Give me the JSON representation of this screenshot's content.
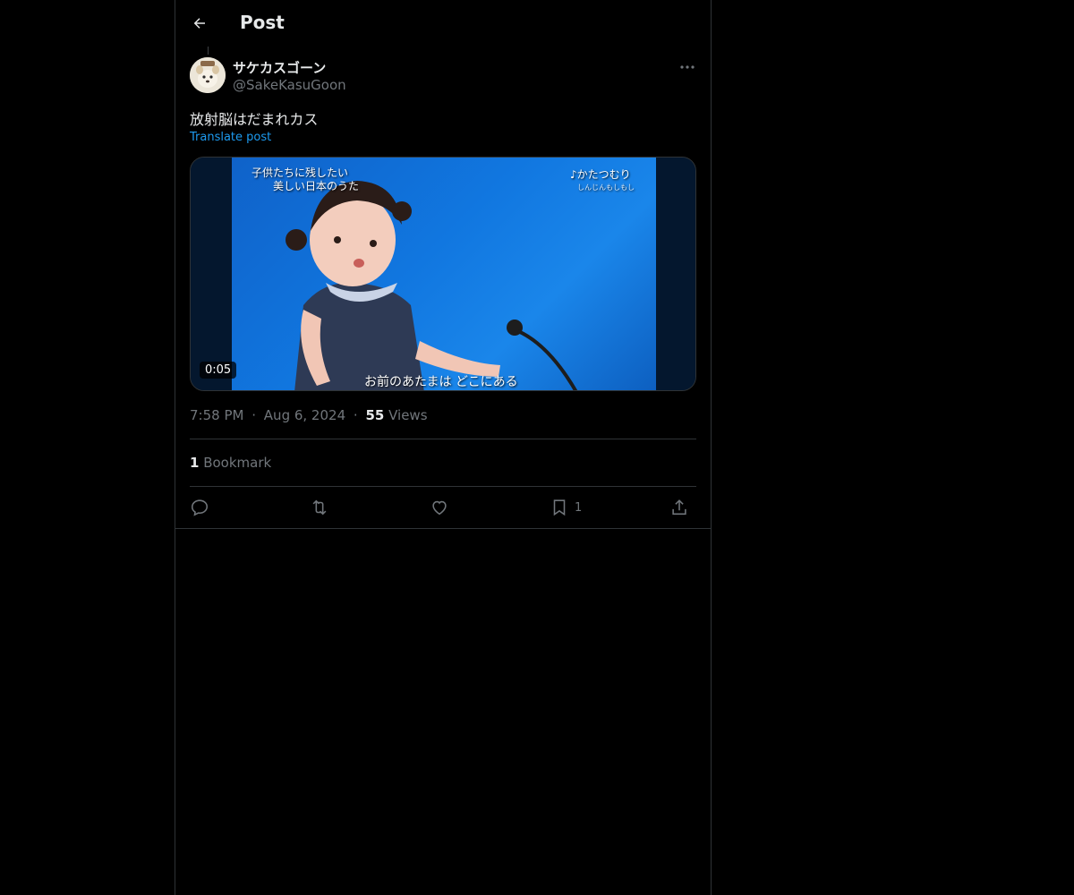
{
  "header": {
    "title": "Post",
    "back_icon": "arrow-left-icon"
  },
  "post": {
    "author": {
      "display_name": "サケカスゴーン",
      "handle": "@SakeKasuGoon",
      "avatar_icon": "avatar-dog-icon"
    },
    "text": "放射脳はだまれカス",
    "translate_label": "Translate post",
    "media": {
      "duration": "0:05",
      "overlay_title_line1": "子供たちに残したい",
      "overlay_title_line2": "美しい日本のうた",
      "overlay_song": "♪かたつむり",
      "overlay_song_sub": "しんじんもしもし",
      "subtitle": "お前のあたまは どこにある"
    },
    "time": "7:58 PM",
    "date": "Aug 6, 2024",
    "separator": "·",
    "views_count": "55",
    "views_label": "Views",
    "bookmark_count": "1",
    "bookmark_label": "Bookmark"
  },
  "actions": {
    "reply_icon": "reply-icon",
    "repost_icon": "repost-icon",
    "like_icon": "heart-icon",
    "bookmark_icon": "bookmark-icon",
    "bookmark_count": "1",
    "share_icon": "share-icon"
  },
  "colors": {
    "background": "#000000",
    "border": "#2f3336",
    "text_primary": "#e7e9ea",
    "text_secondary": "#71767b",
    "accent": "#1d9bf0"
  }
}
